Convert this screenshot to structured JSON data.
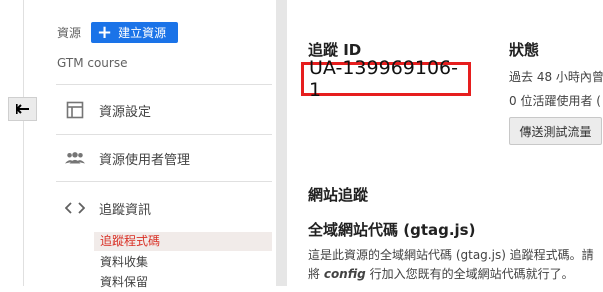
{
  "sidebar": {
    "resource_label": "資源",
    "create_button": "建立資源",
    "property_name": "GTM course",
    "nav": [
      {
        "label": "資源設定",
        "icon": "property-settings-icon"
      },
      {
        "label": "資源使用者管理",
        "icon": "users-icon"
      },
      {
        "label": "追蹤資訊",
        "icon": "code-icon"
      }
    ],
    "sub_items": [
      "追蹤程式碼",
      "資料收集",
      "資料保留"
    ]
  },
  "main": {
    "tracking_id_heading": "追蹤 ID",
    "tracking_id": "UA-139969106-1",
    "status_heading": "狀態",
    "status_line1": "過去 48 小時內曾",
    "status_line2": "0 位活躍使用者 (",
    "send_test_button": "傳送測試流量",
    "site_tracking_heading": "網站追蹤",
    "gtag_heading": "全域網站代碼 (gtag.js)",
    "desc_line1": "這是此資源的全域網站代碼 (gtag.js) 追蹤程式碼。請",
    "desc_line2_pre": "將 ",
    "desc_line2_em": "config",
    "desc_line2_post": " 行加入您既有的全域網站代碼就行了。"
  },
  "colors": {
    "accent": "#1a73e8",
    "highlight": "#e61e1e",
    "active_text": "#d93025"
  }
}
